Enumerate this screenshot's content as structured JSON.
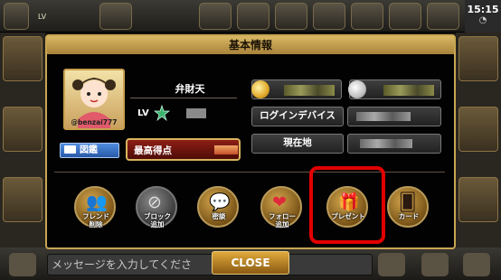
{
  "status_bar": {
    "lv_label": "LV",
    "clock": "15:15"
  },
  "dialog": {
    "title": "基本情報",
    "profile": {
      "name": "弁財天",
      "handle": "@benzai777",
      "level_label": "LV"
    },
    "buttons": {
      "zukan": "図鑑",
      "high_score": "最高得点"
    },
    "info_rows": {
      "login_device": "ログインデバイス",
      "location": "現在地"
    },
    "actions": [
      {
        "name": "friend-delete",
        "label": "フレンド\n削除",
        "style": "gold",
        "icon": "friend-delete-icon"
      },
      {
        "name": "block-add",
        "label": "ブロック\n追加",
        "style": "gray",
        "icon": "block-icon"
      },
      {
        "name": "chat",
        "label": "密談",
        "style": "gold",
        "icon": "chat-icon"
      },
      {
        "name": "follow-add",
        "label": "フォロー\n追加",
        "style": "gold",
        "icon": "heart-plus-icon"
      },
      {
        "name": "present",
        "label": "プレゼント",
        "style": "gold",
        "icon": "gift-icon"
      },
      {
        "name": "card",
        "label": "カード",
        "style": "gold",
        "icon": "card-icon"
      }
    ],
    "close_label": "CLOSE"
  },
  "chat_input": {
    "placeholder": "メッセージを入力してくださ"
  },
  "highlight_color": "#e10000"
}
